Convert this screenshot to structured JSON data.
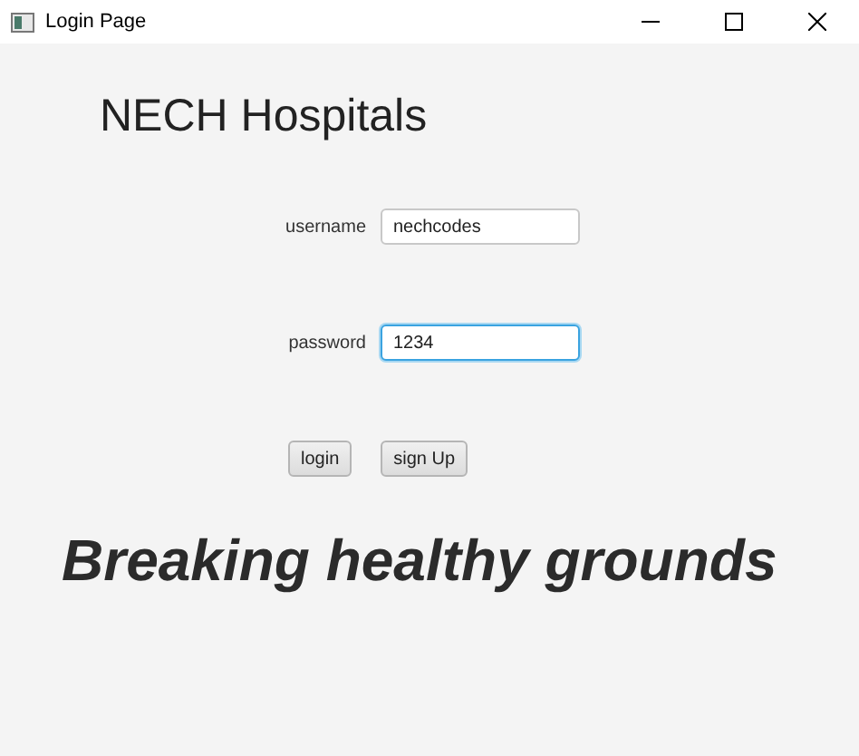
{
  "window": {
    "title": "Login Page"
  },
  "heading": "NECH Hospitals",
  "fields": [
    {
      "label": "username",
      "value": "nechcodes",
      "focused": false
    },
    {
      "label": "password",
      "value": "1234",
      "focused": true
    }
  ],
  "buttons": [
    "login",
    "sign Up"
  ],
  "slogan": "Breaking healthy grounds"
}
